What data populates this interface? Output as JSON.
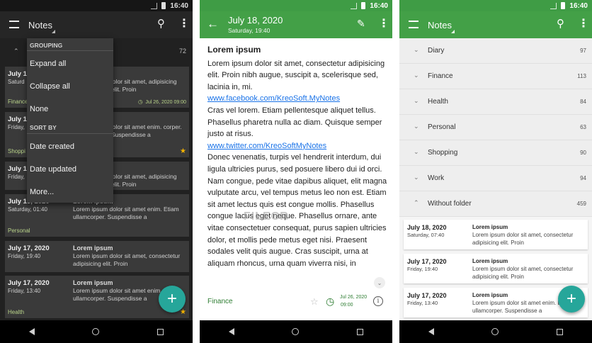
{
  "time": "16:40",
  "phone1": {
    "title": "Notes",
    "group_count": "72",
    "menu": {
      "grouping_label": "GROUPING",
      "expand_all": "Expand all",
      "collapse_all": "Collapse all",
      "none": "None",
      "sort_by_label": "SORT BY",
      "date_created": "Date created",
      "date_updated": "Date updated",
      "more": "More..."
    },
    "notes": [
      {
        "date": "July 18",
        "time": "Saturd",
        "heading": "",
        "body": "lolor sit amet, adipisicing elit. Proin",
        "folder": "Finance",
        "reminder": "Jul 26, 2020 09:00",
        "starred": false
      },
      {
        "date": "July 17",
        "time": "Friday,",
        "heading": "",
        "body": "lolor sit amet enim. corper. Suspendisse a",
        "folder": "Shoppi",
        "reminder": "",
        "starred": true
      },
      {
        "date": "July 17",
        "time": "Friday,",
        "heading": "",
        "body": "lolor sit amet, adipisicing elit. Proin",
        "folder": "",
        "reminder": "",
        "starred": false
      },
      {
        "date": "July 16, 2020",
        "time": "Saturday, 01:40",
        "heading": "Lorem ipsum",
        "body": "Lorem ipsum dolor sit amet enim. Etiam ullamcorper. Suspendisse a",
        "folder": "Personal",
        "reminder": "",
        "starred": false
      },
      {
        "date": "July 17, 2020",
        "time": "Friday, 19:40",
        "heading": "Lorem ipsum",
        "body": "Lorem ipsum dolor sit amet, consectetur adipisicing elit. Proin",
        "folder": "",
        "reminder": "",
        "starred": false
      },
      {
        "date": "July 17, 2020",
        "time": "Friday, 13:40",
        "heading": "Lorem ipsum",
        "body": "Lorem ipsum dolor sit amet enim. Etiam ullamcorper. Suspendisse a",
        "folder": "Health",
        "reminder": "",
        "starred": true
      }
    ]
  },
  "phone2": {
    "date": "July 18, 2020",
    "datetime": "Saturday, 19:40",
    "note_title": "Lorem ipsum",
    "p1": "Lorem ipsum dolor sit amet, consectetur adipisicing elit. Proin nibh augue, suscipit a, scelerisque sed, lacinia in, mi.",
    "link1": "www.facebook.com/KreoSoft.MyNotes",
    "p2": "Cras vel lorem. Etiam pellentesque aliquet tellus. Phasellus pharetra nulla ac diam. Quisque semper justo at risus.",
    "link2": "www.twitter.com/KreoSoftMyNotes",
    "p3": "Donec venenatis, turpis vel hendrerit interdum, dui ligula ultricies purus, sed posuere libero dui id orci. Nam congue, pede vitae dapibus aliquet, elit magna vulputate arcu, vel tempus metus leo non est. Etiam sit amet lectus quis est congue mollis. Phasellus congue lacus eget neque. Phasellus ornare, ante vitae consectetuer consequat, purus sapien ultricies dolor, et mollis pede metus eget nisi. Praesent sodales velit quis augue. Cras suscipit, urna at aliquam rhoncus, urna quam viverra nisi, in",
    "watermark": "FILECR",
    "folder": "Finance",
    "reminder_date": "Jul 26, 2020",
    "reminder_time": "09:00"
  },
  "phone3": {
    "title": "Notes",
    "folders": [
      {
        "name": "Diary",
        "count": "97"
      },
      {
        "name": "Finance",
        "count": "113"
      },
      {
        "name": "Health",
        "count": "84"
      },
      {
        "name": "Personal",
        "count": "63"
      },
      {
        "name": "Shopping",
        "count": "90"
      },
      {
        "name": "Work",
        "count": "94"
      },
      {
        "name": "Without folder",
        "count": "459"
      }
    ],
    "notes": [
      {
        "date": "July 18, 2020",
        "time": "Saturday, 07:40",
        "heading": "Lorem ipsum",
        "body": "Lorem ipsum dolor sit amet, consectetur adipisicing elit. Proin"
      },
      {
        "date": "July 17, 2020",
        "time": "Friday, 19:40",
        "heading": "Lorem ipsum",
        "body": "Lorem ipsum dolor sit amet, consectetur adipisicing elit. Proin"
      },
      {
        "date": "July 17, 2020",
        "time": "Friday, 13:40",
        "heading": "Lorem ipsum",
        "body": "Lorem ipsum dolor sit amet enim. Etiam ullamcorper. Suspendisse a"
      }
    ]
  },
  "colors": {
    "green": "#43a047",
    "fab": "#26a69a",
    "dark": "#212121",
    "link": "#1a73e8"
  }
}
